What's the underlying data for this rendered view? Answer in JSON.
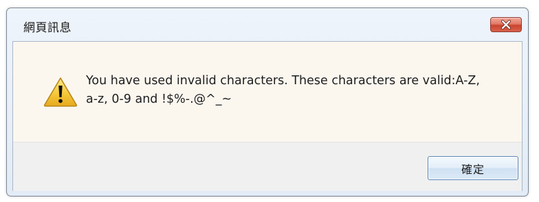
{
  "dialog": {
    "title": "網頁訊息",
    "message": "You have used invalid characters. These characters are valid:A-Z,\na-z, 0-9 and !$%-.@^_~",
    "icon": "warning-icon",
    "ok_label": "確定",
    "close_icon": "close-icon"
  },
  "colors": {
    "close_button": "#d9624c",
    "content_background": "#fbf7ef",
    "warning_yellow": "#f3c531"
  }
}
